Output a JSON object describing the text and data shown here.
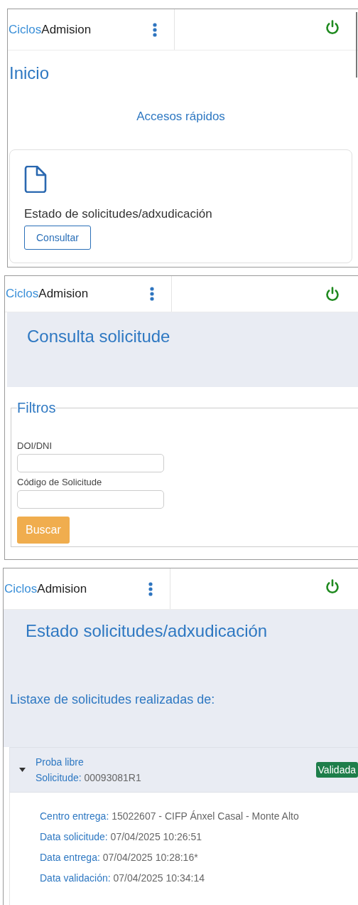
{
  "panels": [
    {
      "kind": "home",
      "header": {
        "brand_accent": "Ciclos",
        "brand": "Admision"
      },
      "title": "Inicio",
      "section_title": "Accesos rápidos",
      "shortcuts": [
        {
          "label": "Estado de solicitudes/adxudicación",
          "button": "Consultar"
        }
      ]
    },
    {
      "kind": "search",
      "header": {
        "brand_accent": "Ciclos",
        "brand": "Admision"
      },
      "title": "Consulta solicitude",
      "filters": {
        "legend": "Filtros",
        "fields": [
          {
            "label": "DOI/DNI"
          },
          {
            "label": "Código de Solicitude"
          }
        ],
        "button": "Buscar"
      }
    },
    {
      "kind": "status",
      "header": {
        "brand_accent": "Ciclos",
        "brand": "Admision"
      },
      "title": "Estado solicitudes/adxudicación",
      "list_caption": "Listaxe de solicitudes realizadas de:",
      "requests": [
        {
          "expanded": true,
          "type": "Proba libre",
          "code_label": "Solicitude:",
          "code": "00093081R1",
          "status": "Validada",
          "details": [
            {
              "label": "Centro entrega:",
              "value": "15022607 - CIFP Ánxel Casal - Monte Alto"
            },
            {
              "label": "Data solicitude:",
              "value": "07/04/2025 10:26:51"
            },
            {
              "label": "Data entrega:",
              "value": "07/04/2025 10:28:16*"
            },
            {
              "label": "Data validación:",
              "value": "07/04/2025 10:34:14"
            }
          ]
        }
      ]
    }
  ]
}
